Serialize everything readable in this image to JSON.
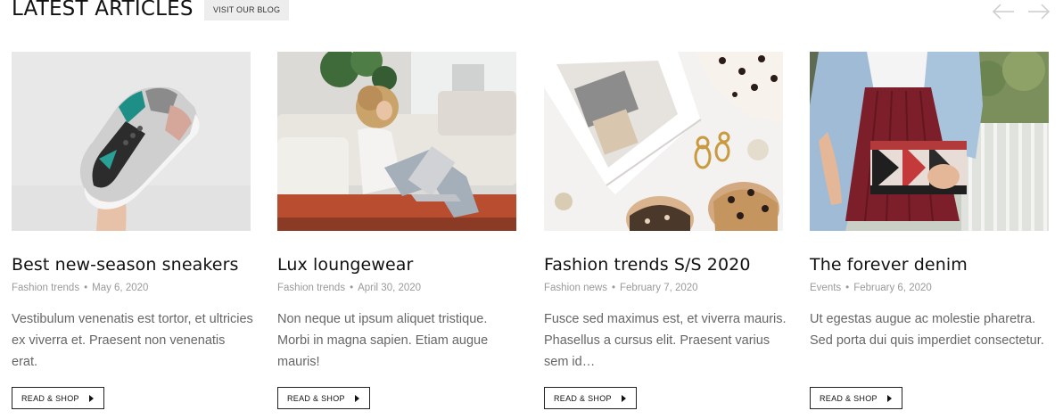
{
  "header": {
    "title": "LATEST ARTICLES",
    "blog_link": "VISIT OUR BLOG"
  },
  "articles": [
    {
      "title": "Best new-season sneakers",
      "category": "Fashion trends",
      "date": "May 6, 2020",
      "excerpt": "Vestibulum venenatis est tortor, et ultricies ex viverra et. Praesent non venenatis erat.",
      "button": "READ & SHOP",
      "image": "sneaker-in-hand-photo"
    },
    {
      "title": "Lux loungewear",
      "category": "Fashion trends",
      "date": "April 30, 2020",
      "excerpt": "Non neque ut ipsum aliquet tristique. Morbi in magna sapien. Etiam augue mauris!",
      "button": "READ & SHOP",
      "image": "woman-with-laptop-photo"
    },
    {
      "title": "Fashion trends S/S 2020",
      "category": "Fashion news",
      "date": "February 7, 2020",
      "excerpt": "Fusce sed maximus est, et viverra mauris. Phasellus a cursus elit. Praesent varius sem id…",
      "button": "READ & SHOP",
      "image": "flatlay-sandals-earrings-photo"
    },
    {
      "title": "The forever denim",
      "category": "Events",
      "date": "February 6, 2020",
      "excerpt": "Ut egestas augue ac molestie pharetra. Sed porta dui quis imperdiet consectetur.",
      "button": "READ & SHOP",
      "image": "denim-jacket-clutch-photo"
    }
  ],
  "colors": {
    "title": "#111111",
    "meta": "#9a9a9a",
    "excerpt": "#666666",
    "blog_link_bg": "#ededed",
    "arrow": "#cccccc"
  }
}
